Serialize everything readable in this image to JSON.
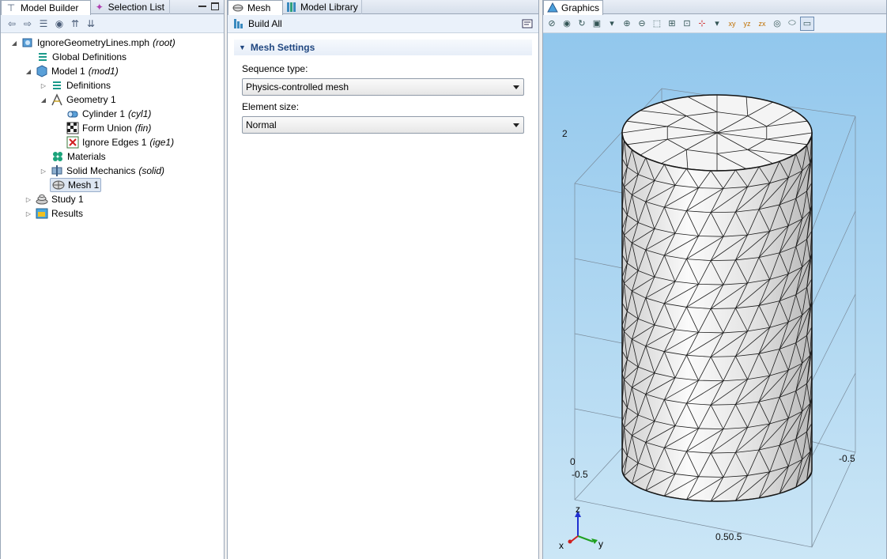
{
  "model_builder": {
    "tabs": [
      {
        "label": "Model Builder",
        "icon": "model-builder-icon",
        "active": true
      },
      {
        "label": "Selection List",
        "icon": "selection-list-icon",
        "active": false
      }
    ],
    "tree": [
      {
        "label": "IgnoreGeometryLines.mph",
        "tag": "(root)",
        "icon": "file-icon",
        "arrow": "expanded",
        "level": 0
      },
      {
        "label": "Global Definitions",
        "tag": "",
        "icon": "global-definitions-icon",
        "arrow": "none",
        "level": 1
      },
      {
        "label": "Model 1",
        "tag": "(mod1)",
        "icon": "model-icon",
        "arrow": "expanded",
        "level": 1
      },
      {
        "label": "Definitions",
        "tag": "",
        "icon": "definitions-icon",
        "arrow": "collapsed",
        "level": 2
      },
      {
        "label": "Geometry 1",
        "tag": "",
        "icon": "geometry-icon",
        "arrow": "expanded",
        "level": 2
      },
      {
        "label": "Cylinder 1",
        "tag": "(cyl1)",
        "icon": "cylinder-icon",
        "arrow": "none",
        "level": 3
      },
      {
        "label": "Form Union",
        "tag": "(fin)",
        "icon": "form-union-icon",
        "arrow": "none",
        "level": 3
      },
      {
        "label": "Ignore Edges 1",
        "tag": "(ige1)",
        "icon": "ignore-edges-icon",
        "arrow": "none",
        "level": 3
      },
      {
        "label": "Materials",
        "tag": "",
        "icon": "materials-icon",
        "arrow": "none",
        "level": 2
      },
      {
        "label": "Solid Mechanics",
        "tag": "(solid)",
        "icon": "solid-mechanics-icon",
        "arrow": "collapsed",
        "level": 2
      },
      {
        "label": "Mesh 1",
        "tag": "",
        "icon": "mesh-icon",
        "arrow": "none",
        "level": 2,
        "selected": true
      },
      {
        "label": "Study 1",
        "tag": "",
        "icon": "study-icon",
        "arrow": "collapsed",
        "level": 1
      },
      {
        "label": "Results",
        "tag": "",
        "icon": "results-icon",
        "arrow": "collapsed",
        "level": 1
      }
    ]
  },
  "settings": {
    "tabs": [
      {
        "label": "Mesh",
        "icon": "mesh-icon",
        "active": true
      },
      {
        "label": "Model Library",
        "icon": "model-library-icon",
        "active": false
      }
    ],
    "build_all": "Build All",
    "section_title": "Mesh Settings",
    "sequence_type_label": "Sequence type:",
    "sequence_type_value": "Physics-controlled mesh",
    "element_size_label": "Element size:",
    "element_size_value": "Normal"
  },
  "graphics": {
    "tab_label": "Graphics",
    "axis_labels": {
      "z_top": "2",
      "z_bottom": "0",
      "x_left": "-0.5",
      "y_right": "-0.5",
      "bottom_pair": "0.50.5"
    },
    "triad": {
      "x": "x",
      "y": "y",
      "z": "z"
    },
    "colors": {
      "background_top": "#8ec5ec",
      "background_bottom": "#cbe6f6",
      "mesh_face": "#f2f2f2",
      "mesh_edge": "#111111"
    }
  }
}
